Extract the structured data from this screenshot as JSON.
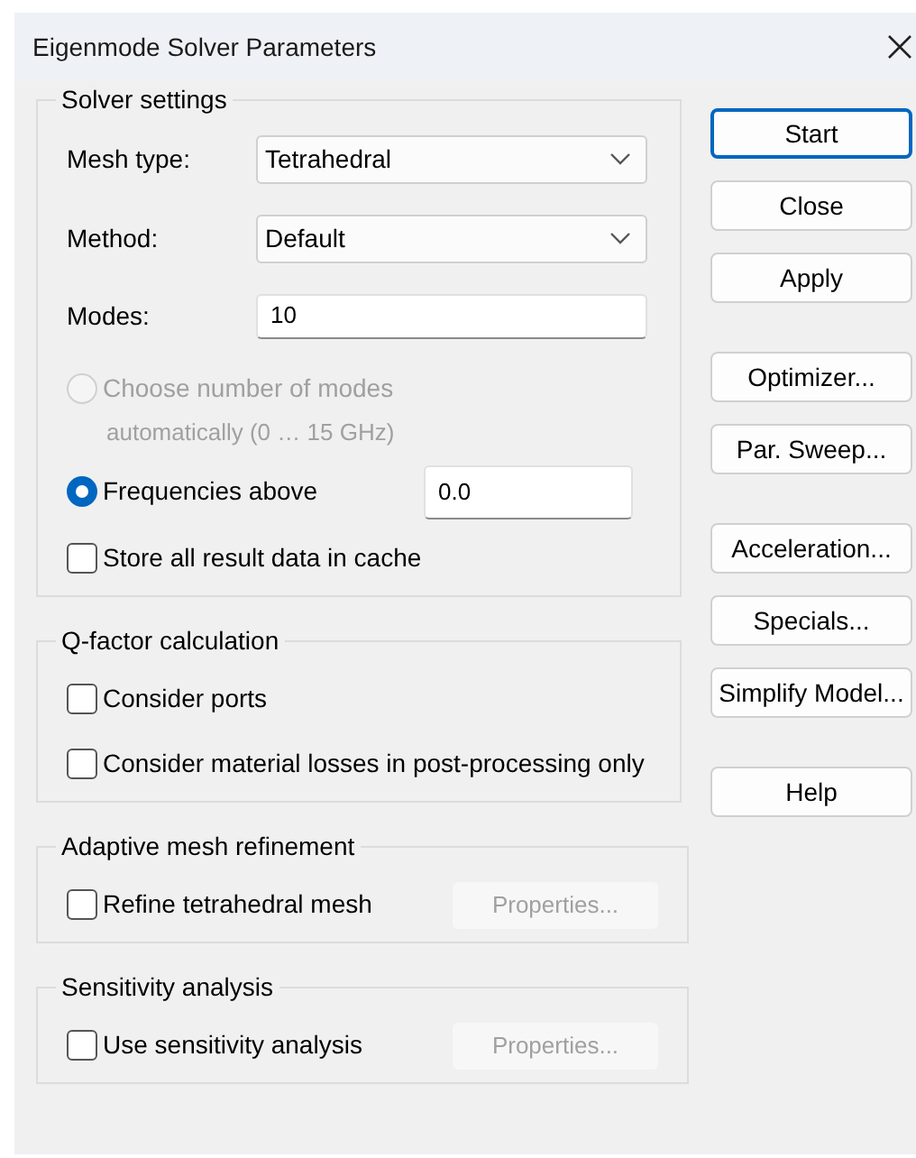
{
  "window": {
    "title": "Eigenmode Solver Parameters"
  },
  "groups": [
    {
      "title": "Solver settings",
      "rows": [
        {
          "kind": "select",
          "label": "Mesh type:",
          "value": "Tetrahedral"
        },
        {
          "kind": "select",
          "label": "Method:",
          "value": "Default"
        },
        {
          "kind": "input",
          "label": "Modes:",
          "value": "10"
        },
        {
          "kind": "radio",
          "label": "Choose number of modes",
          "note": "automatically (0 … 15 GHz)",
          "selected": false,
          "disabled": true
        },
        {
          "kind": "radio",
          "label": "Frequencies above",
          "value": "0.0",
          "selected": true,
          "disabled": false
        },
        {
          "kind": "checkbox",
          "label": "Store all result data in cache",
          "checked": false
        }
      ]
    },
    {
      "title": "Q-factor calculation",
      "rows": [
        {
          "kind": "checkbox",
          "label": "Consider ports",
          "checked": false
        },
        {
          "kind": "checkbox",
          "label": "Consider material losses in post-processing only",
          "checked": false
        }
      ]
    },
    {
      "title": "Adaptive mesh refinement",
      "rows": [
        {
          "kind": "checkbox",
          "label": "Refine tetrahedral mesh",
          "checked": false,
          "button": {
            "label": "Properties...",
            "disabled": true
          }
        }
      ]
    },
    {
      "title": "Sensitivity analysis",
      "rows": [
        {
          "kind": "checkbox",
          "label": "Use sensitivity analysis",
          "checked": false,
          "button": {
            "label": "Properties...",
            "disabled": true
          }
        }
      ]
    }
  ],
  "button_groups": [
    [
      {
        "label": "Start",
        "default": true
      },
      {
        "label": "Close",
        "default": false
      },
      {
        "label": "Apply",
        "default": false
      }
    ],
    [
      {
        "label": "Optimizer...",
        "default": false
      },
      {
        "label": "Par. Sweep...",
        "default": false
      }
    ],
    [
      {
        "label": "Acceleration...",
        "default": false
      },
      {
        "label": "Specials...",
        "default": false
      },
      {
        "label": "Simplify Model...",
        "default": false
      }
    ],
    [
      {
        "label": "Help",
        "default": false
      }
    ]
  ]
}
